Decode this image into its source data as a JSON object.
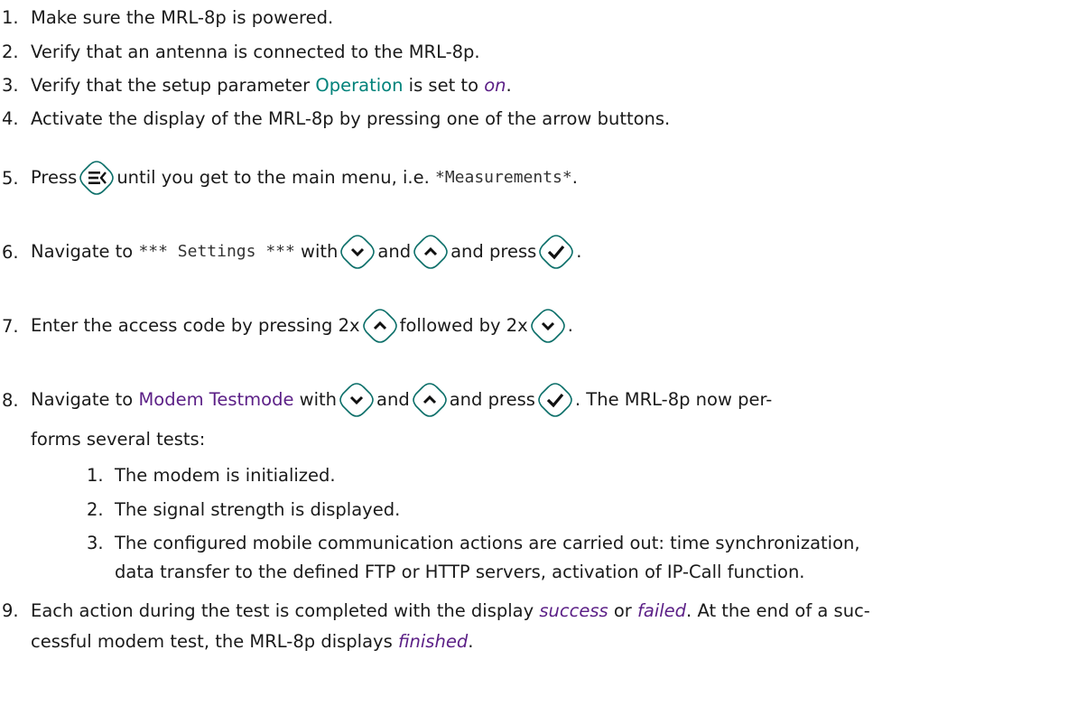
{
  "steps": [
    {
      "n": "1.",
      "text": "Make sure the MRL-8p is powered."
    },
    {
      "n": "2.",
      "text": "Verify that an antenna is connected to the MRL-8p."
    },
    {
      "n": "3.",
      "pre": "Verify that the setup parameter ",
      "param": "Operation",
      "mid": " is set to ",
      "value": "on",
      "post": "."
    },
    {
      "n": "4.",
      "text": "Activate the display of the MRL-8p by pressing one of the arrow buttons."
    },
    {
      "n": "5.",
      "pre": "Press",
      "post": "until you get to the main menu, i.e. ",
      "code": "*Measurements*",
      "end": "."
    },
    {
      "n": "6.",
      "pre": "Navigate to ",
      "code": "*** Settings ***",
      "mid1": " with",
      "mid2": "and",
      "mid3": "and press",
      "end": "."
    },
    {
      "n": "7.",
      "pre": "Enter the access code by pressing 2x",
      "mid": "followed by 2x",
      "end": "."
    },
    {
      "n": "8.",
      "pre": "Navigate to ",
      "link": "Modem Testmode",
      "mid1": " with",
      "mid2": "and",
      "mid3": "and press",
      "post": ". The MRL-8p now per-",
      "line2": "forms several tests:"
    },
    {
      "n": "9.",
      "pre": "Each action during the test is completed with the display ",
      "success": "success",
      "or": " or ",
      "failed": "failed",
      "post": ". At the end of a suc-",
      "line2pre": "cessful modem test, the MRL-8p displays ",
      "finished": "finished",
      "line2end": "."
    }
  ],
  "substeps": [
    {
      "n": "1.",
      "text": "The modem is initialized."
    },
    {
      "n": "2.",
      "text": "The signal strength is displayed."
    },
    {
      "n": "3.",
      "line1": "The configured mobile communication actions are carried out: time synchronization,",
      "line2": "data transfer to the defined FTP or HTTP servers, activation of IP-Call function."
    }
  ],
  "icons": {
    "menu": "menu-back-icon",
    "down": "chevron-down-icon",
    "up": "chevron-up-icon",
    "ok": "checkmark-icon"
  },
  "colors": {
    "teal": "#00827a",
    "purple": "#5b1f86",
    "icon_stroke": "#0a6e68"
  }
}
